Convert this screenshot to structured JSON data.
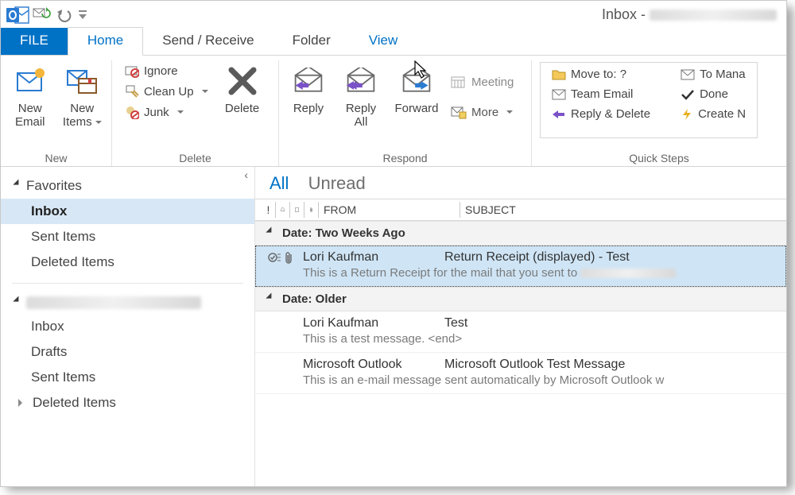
{
  "titlebar": {
    "title_prefix": "Inbox - "
  },
  "tabs": {
    "file": "FILE",
    "items": [
      "Home",
      "Send / Receive",
      "Folder",
      "View"
    ],
    "activeIndex": 0,
    "hoverIndex": 3
  },
  "ribbon": {
    "new": {
      "label": "New",
      "newEmail_l1": "New",
      "newEmail_l2": "Email",
      "newItems_l1": "New",
      "newItems_l2": "Items"
    },
    "delete": {
      "label": "Delete",
      "ignore": "Ignore",
      "cleanUp": "Clean Up",
      "junk": "Junk",
      "delete": "Delete"
    },
    "respond": {
      "label": "Respond",
      "reply": "Reply",
      "replyAll_l1": "Reply",
      "replyAll_l2": "All",
      "forward": "Forward",
      "meeting": "Meeting",
      "more": "More"
    },
    "quickSteps": {
      "label": "Quick Steps",
      "moveTo": "Move to: ?",
      "teamEmail": "Team Email",
      "replyDelete": "Reply & Delete",
      "toManager": "To Mana",
      "done": "Done",
      "createNew": "Create N"
    }
  },
  "nav": {
    "favorites": "Favorites",
    "favItems": [
      "Inbox",
      "Sent Items",
      "Deleted Items"
    ],
    "favSelected": 0,
    "acctItems": [
      "Inbox",
      "Drafts",
      "Sent Items",
      "Deleted Items"
    ]
  },
  "list": {
    "filters": {
      "all": "All",
      "unread": "Unread"
    },
    "headers": {
      "from": "FROM",
      "subject": "SUBJECT"
    },
    "groups": [
      {
        "label": "Date: Two Weeks Ago",
        "messages": [
          {
            "from": "Lori Kaufman",
            "subject": "Return Receipt (displayed) - Test",
            "preview": "This is a Return Receipt for the mail that you sent to ",
            "selected": true,
            "hasReceipt": true,
            "hasAttachment": true
          }
        ]
      },
      {
        "label": "Date: Older",
        "messages": [
          {
            "from": "Lori Kaufman",
            "subject": "Test",
            "preview": "This is a test message. <end>",
            "selected": false
          },
          {
            "from": "Microsoft Outlook",
            "subject": "Microsoft Outlook Test Message",
            "preview": "This is an e-mail message sent automatically by Microsoft Outlook w",
            "selected": false
          }
        ]
      }
    ]
  }
}
